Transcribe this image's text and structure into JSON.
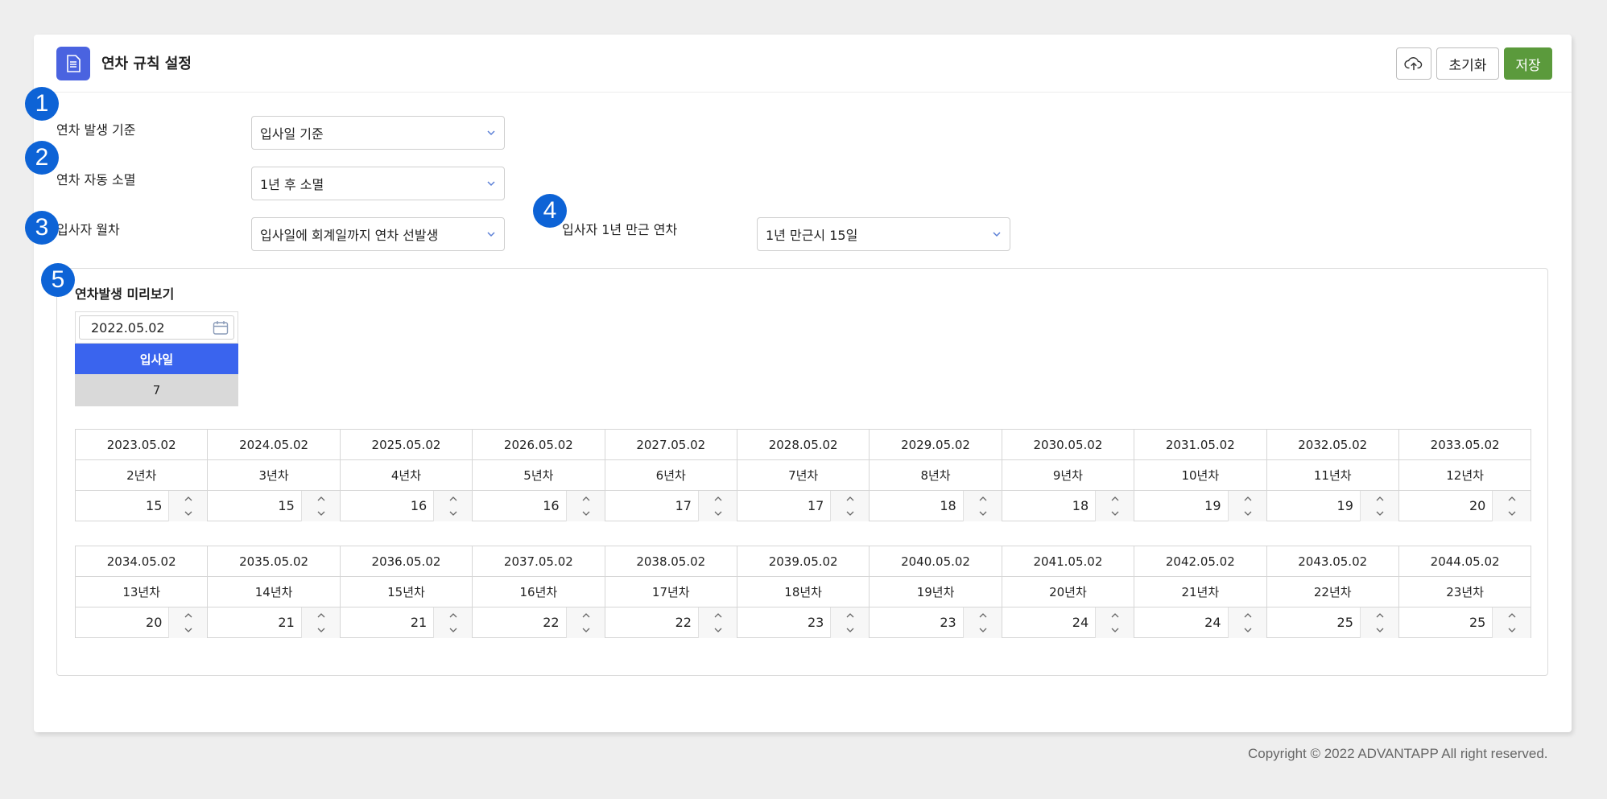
{
  "page": {
    "title": "연차 규칙 설정",
    "icon": "document-icon",
    "accent": "#4a63e0"
  },
  "toolbar": {
    "upload_icon": "cloud-upload-icon",
    "reset_label": "초기화",
    "save_label": "저장",
    "save_color": "#5b9a3c"
  },
  "badges": [
    "1",
    "2",
    "3",
    "4",
    "5"
  ],
  "fields": {
    "leave_basis": {
      "label": "연차 발생 기준",
      "value": "입사일 기준"
    },
    "auto_expire": {
      "label": "연차 자동 소멸",
      "value": "1년 후 소멸"
    },
    "monthly_leave": {
      "label": "입사자 월차",
      "value": "입사일에 회계일까지 연차 선발생"
    },
    "first_year": {
      "label": "입사자 1년 만근 연차",
      "value": "1년 만근시 15일"
    }
  },
  "preview": {
    "title": "연차발생 미리보기",
    "hire_date": "2022.05.02",
    "hire_header": "입사일",
    "hire_value": "7",
    "rows": [
      {
        "dates": [
          "2023.05.02",
          "2024.05.02",
          "2025.05.02",
          "2026.05.02",
          "2027.05.02",
          "2028.05.02",
          "2029.05.02",
          "2030.05.02",
          "2031.05.02",
          "2032.05.02",
          "2033.05.02"
        ],
        "years": [
          "2년차",
          "3년차",
          "4년차",
          "5년차",
          "6년차",
          "7년차",
          "8년차",
          "9년차",
          "10년차",
          "11년차",
          "12년차"
        ],
        "days": [
          "15",
          "15",
          "16",
          "16",
          "17",
          "17",
          "18",
          "18",
          "19",
          "19",
          "20"
        ]
      },
      {
        "dates": [
          "2034.05.02",
          "2035.05.02",
          "2036.05.02",
          "2037.05.02",
          "2038.05.02",
          "2039.05.02",
          "2040.05.02",
          "2041.05.02",
          "2042.05.02",
          "2043.05.02",
          "2044.05.02"
        ],
        "years": [
          "13년차",
          "14년차",
          "15년차",
          "16년차",
          "17년차",
          "18년차",
          "19년차",
          "20년차",
          "21년차",
          "22년차",
          "23년차"
        ],
        "days": [
          "20",
          "21",
          "21",
          "22",
          "22",
          "23",
          "23",
          "24",
          "24",
          "25",
          "25"
        ]
      }
    ]
  },
  "footer": {
    "copyright": "Copyright © 2022 ADVANTAPP All right reserved."
  },
  "colors": {
    "badge": "#0d63d6",
    "hire_header": "#3a64ee",
    "hire_value_bg": "#d9d9d9"
  }
}
